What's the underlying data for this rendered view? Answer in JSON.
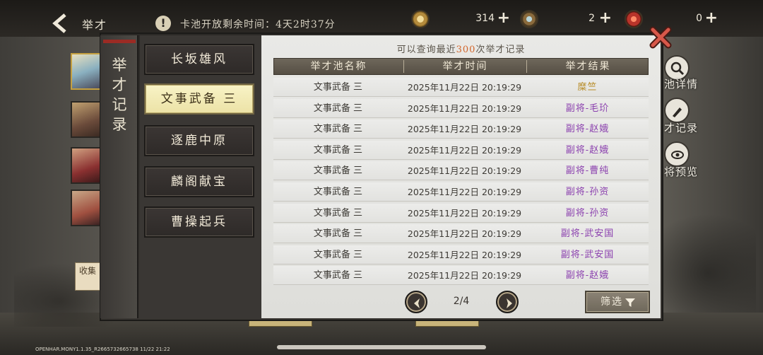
{
  "topbar": {
    "title": "举才",
    "notice": "卡池开放剩余时间：4天2时37分",
    "resources": [
      {
        "icon": "coin-icon",
        "value": "314"
      },
      {
        "icon": "token-icon",
        "value": "2"
      },
      {
        "icon": "jade-icon",
        "value": "0"
      }
    ]
  },
  "left_decor": {
    "collect_label": "收集"
  },
  "side_menu": [
    {
      "label": "池详情",
      "icon": "magnifier-icon"
    },
    {
      "label": "才记录",
      "icon": "brush-icon"
    },
    {
      "label": "将预览",
      "icon": "eye-icon"
    }
  ],
  "modal": {
    "tab_title": "举才记录",
    "categories": [
      {
        "label": "长坂雄风",
        "active": false
      },
      {
        "label": "文事武备 三",
        "active": true
      },
      {
        "label": "逐鹿中原",
        "active": false
      },
      {
        "label": "麟阁献宝",
        "active": false
      },
      {
        "label": "曹操起兵",
        "active": false
      }
    ],
    "note_prefix": "可以查询最近",
    "note_count": "300",
    "note_suffix": "次举才记录",
    "table": {
      "headers": [
        "举才池名称",
        "举才时间",
        "举才结果"
      ],
      "rows": [
        {
          "pool": "文事武备 三",
          "time": "2025年11月22日 20:19:29",
          "result": "糜竺",
          "rarity": "gold"
        },
        {
          "pool": "文事武备 三",
          "time": "2025年11月22日 20:19:29",
          "result": "副将-毛玠",
          "rarity": "purple"
        },
        {
          "pool": "文事武备 三",
          "time": "2025年11月22日 20:19:29",
          "result": "副将-赵娥",
          "rarity": "purple"
        },
        {
          "pool": "文事武备 三",
          "time": "2025年11月22日 20:19:29",
          "result": "副将-赵娥",
          "rarity": "purple"
        },
        {
          "pool": "文事武备 三",
          "time": "2025年11月22日 20:19:29",
          "result": "副将-曹纯",
          "rarity": "purple"
        },
        {
          "pool": "文事武备 三",
          "time": "2025年11月22日 20:19:29",
          "result": "副将-孙资",
          "rarity": "purple"
        },
        {
          "pool": "文事武备 三",
          "time": "2025年11月22日 20:19:29",
          "result": "副将-孙资",
          "rarity": "purple"
        },
        {
          "pool": "文事武备 三",
          "time": "2025年11月22日 20:19:29",
          "result": "副将-武安国",
          "rarity": "purple"
        },
        {
          "pool": "文事武备 三",
          "time": "2025年11月22日 20:19:29",
          "result": "副将-武安国",
          "rarity": "purple"
        },
        {
          "pool": "文事武备 三",
          "time": "2025年11月22日 20:19:29",
          "result": "副将-赵娥",
          "rarity": "purple"
        }
      ]
    },
    "pagination": {
      "current": 2,
      "total": 4,
      "text": "2/4"
    },
    "filter_label": "筛选"
  },
  "colors": {
    "accent": "#d2652a",
    "purple_result": "#8a3fae",
    "gold_result": "#b68a24",
    "active_tab": "#f8f3c6"
  },
  "footer": {
    "build_info": "OPENHAR.MONY1.1.35_R2665732665738 11/22 21:22"
  }
}
